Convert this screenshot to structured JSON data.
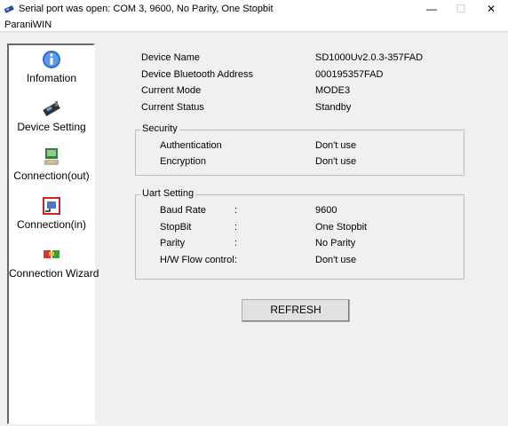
{
  "window": {
    "title": "Serial port was open: COM 3, 9600, No Parity, One Stopbit",
    "minimize_glyph": "—",
    "maximize_glyph": "☐",
    "close_glyph": "✕",
    "app_icon": "paranicom-icon"
  },
  "menu": {
    "items": [
      "ParaniWIN"
    ]
  },
  "sidebar": {
    "items": [
      {
        "label": "Infomation",
        "icon": "info-icon"
      },
      {
        "label": "Device Setting",
        "icon": "device-setting-icon"
      },
      {
        "label": "Connection(out)",
        "icon": "connection-out-icon"
      },
      {
        "label": "Connection(in)",
        "icon": "connection-in-icon"
      },
      {
        "label": "Connection Wizard",
        "icon": "connection-wizard-icon"
      }
    ]
  },
  "device": {
    "name_label": "Device Name",
    "name_value": "SD1000Uv2.0.3-357FAD",
    "addr_label": "Device Bluetooth Address",
    "addr_value": "000195357FAD",
    "mode_label": "Current Mode",
    "mode_value": "MODE3",
    "status_label": "Current Status",
    "status_value": "Standby"
  },
  "security": {
    "title": "Security",
    "auth_label": "Authentication",
    "auth_value": "Don't use",
    "enc_label": "Encryption",
    "enc_value": "Don't use"
  },
  "uart": {
    "title": "Uart Setting",
    "baud_label": "Baud Rate",
    "baud_value": "9600",
    "stop_label": "StopBit",
    "stop_value": "One Stopbit",
    "parity_label": "Parity",
    "parity_value": "No Parity",
    "flow_label": "H/W Flow control",
    "flow_value": "Don't use",
    "colon": ":"
  },
  "actions": {
    "refresh_label": "REFRESH"
  }
}
